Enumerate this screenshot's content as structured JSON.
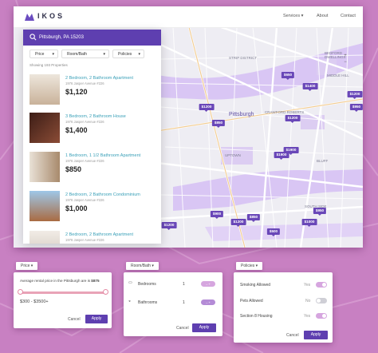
{
  "app": {
    "brand": "IKOS",
    "nav": [
      "Services ▾",
      "About",
      "Contact"
    ]
  },
  "search": {
    "value": "Pittsburgh, PA 15203"
  },
  "filters": [
    "Price",
    "Room/Bath",
    "Policies"
  ],
  "results_count": "Showing 193 Properties",
  "listings": [
    {
      "title": "2 Bedroom, 2 Bathroom Apartment",
      "address": "1976 Jasper Avenue #226",
      "price": "$1,120",
      "img": "#c9b29a"
    },
    {
      "title": "3 Bedroom, 2 Bathroom House",
      "address": "1976 Jasper Avenue #226",
      "price": "$1,400",
      "img": "#6d3a2c"
    },
    {
      "title": "1 Bedroom, 1 1/2 Bathroom Apartment",
      "address": "1976 Jasper Avenue #226",
      "price": "$850",
      "img": "#b9a087"
    },
    {
      "title": "2 Bedroom, 2 Bathroom Condominium",
      "address": "1976 Jasper Avenue #226",
      "price": "$1,000",
      "img": "#a96b42"
    },
    {
      "title": "2 Bedroom, 2 Bathroom Apartment",
      "address": "1976 Jasper Avenue #226",
      "price": "",
      "img": "#cfc3b8"
    }
  ],
  "map": {
    "city_label": "Pittsburgh",
    "labels": [
      "BEDFORD DWELLINGS",
      "MIDDLE HILL",
      "CRAWFORD ROBERTS",
      "UPTOWN",
      "BLUFF",
      "SOUTH SIDE",
      "STRIP DISTRICT"
    ],
    "pins": [
      "$650",
      "$1200",
      "$1400",
      "$1200",
      "$850",
      "$1200",
      "$1900",
      "$1900",
      "$900",
      "$950",
      "$1200",
      "$850",
      "$1000",
      "$1200",
      "$500",
      "$950"
    ]
  },
  "price_card": {
    "tag": "Price ▾",
    "text_pre": "Average rental price in the Pittsburgh are is ",
    "text_value": "$875",
    "range": "$300 - $3500+",
    "cancel": "Cancel",
    "apply": "Apply"
  },
  "room_card": {
    "tag": "Room/Bath ▾",
    "rows": [
      {
        "label": "Bedrooms",
        "value": "1"
      },
      {
        "label": "Bathrooms",
        "value": "1"
      }
    ],
    "cancel": "Cancel",
    "apply": "Apply"
  },
  "policy_card": {
    "tag": "Policies ▾",
    "rows": [
      {
        "label": "Smoking Allowed",
        "value": "Yes",
        "on": true
      },
      {
        "label": "Pets Allowed",
        "value": "No",
        "on": false
      },
      {
        "label": "Section 8 Housing",
        "value": "Yes",
        "on": true
      }
    ],
    "cancel": "Cancel",
    "apply": "Apply"
  },
  "colors": {
    "accent": "#5e3fb0",
    "pin": "#6947b8",
    "background": "#c880c2",
    "link": "#3aa0b8"
  }
}
